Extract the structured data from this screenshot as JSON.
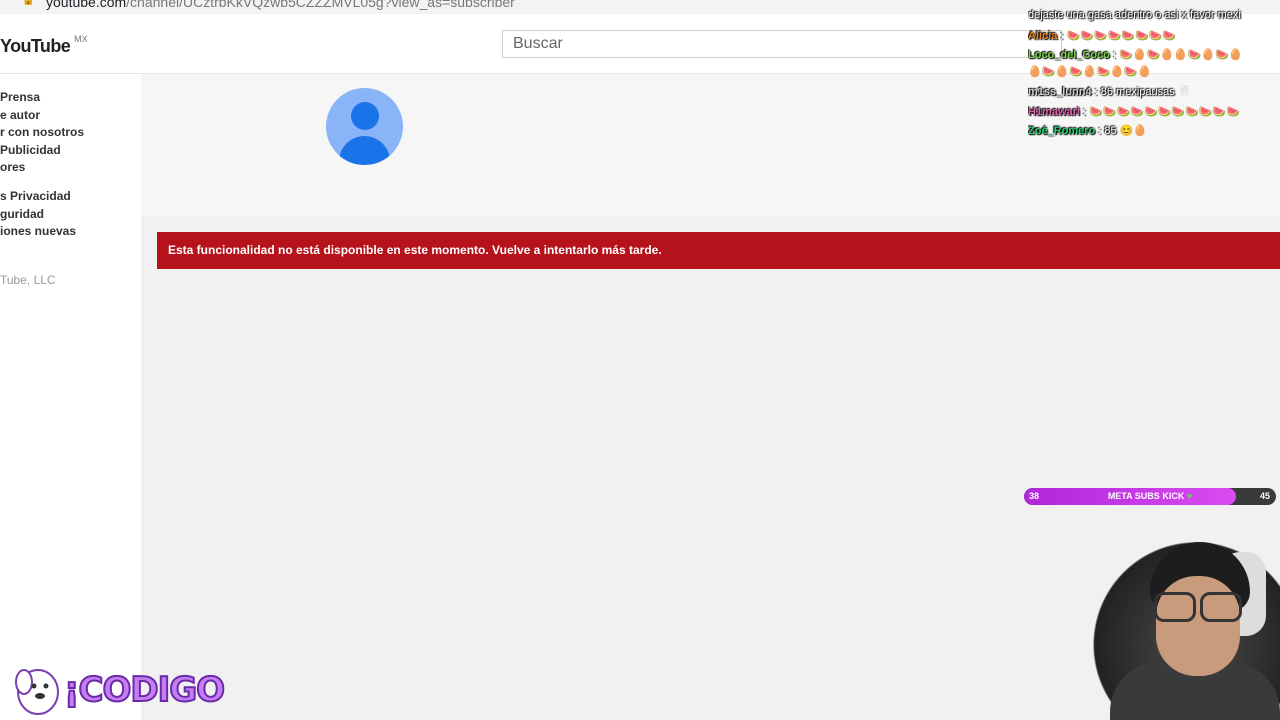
{
  "browser": {
    "url_domain": "youtube.com",
    "url_rest": "/channel/UCztrbKkVQzwb5CZZZMVL05g?view_as=subscriber"
  },
  "masthead": {
    "logo_text": "YouTube",
    "country_code": "MX",
    "search_placeholder": "Buscar"
  },
  "guide": {
    "links": [
      "Prensa",
      "e autor",
      "r con nosotros",
      "Publicidad",
      "ores",
      "s  Privacidad",
      "guridad",
      "iones nuevas"
    ],
    "copyright": "Tube, LLC"
  },
  "error_message": "Esta funcionalidad no está disponible en este momento. Vuelve a intentarlo más tarde.",
  "stream_overlay": {
    "chat": [
      {
        "user": "",
        "text": "dejaste una gasa adentro o asi x favor mexi",
        "user_color": "#ffffff",
        "emotes": ""
      },
      {
        "user": "Alicia",
        "text": "",
        "user_color": "#e8871e",
        "emotes": "🍉🍉🍉🍉🍉🍉🍉🍉"
      },
      {
        "user": "Loco_del_Coco",
        "text": "",
        "user_color": "#7bd148",
        "emotes": "🍉🥚🍉🥚🥚🍉🥚🍉🥚"
      },
      {
        "user": "",
        "text": "",
        "user_color": "#ffffff",
        "emotes": "🥚🍉🥚🍉🥚🍉🥚🍉🥚"
      },
      {
        "user": "m1ss_lunn4",
        "text": "86 mexipausas",
        "user_color": "#cfcfcf",
        "emotes": "🦷"
      },
      {
        "user": "H1mawari",
        "text": "",
        "user_color": "#e060b0",
        "emotes": "🍉🍉🍉🍉🍉🍉🍉🍉🍉🍉🍉"
      },
      {
        "user": "Zoé_Romero",
        "text": "85",
        "user_color": "#2ecc71",
        "emotes": "😊🥚"
      }
    ],
    "goal": {
      "label": "META SUBS KICK",
      "current": "38",
      "target": "45",
      "progress": 0.84
    }
  },
  "brand_text": "¡CODIGO"
}
